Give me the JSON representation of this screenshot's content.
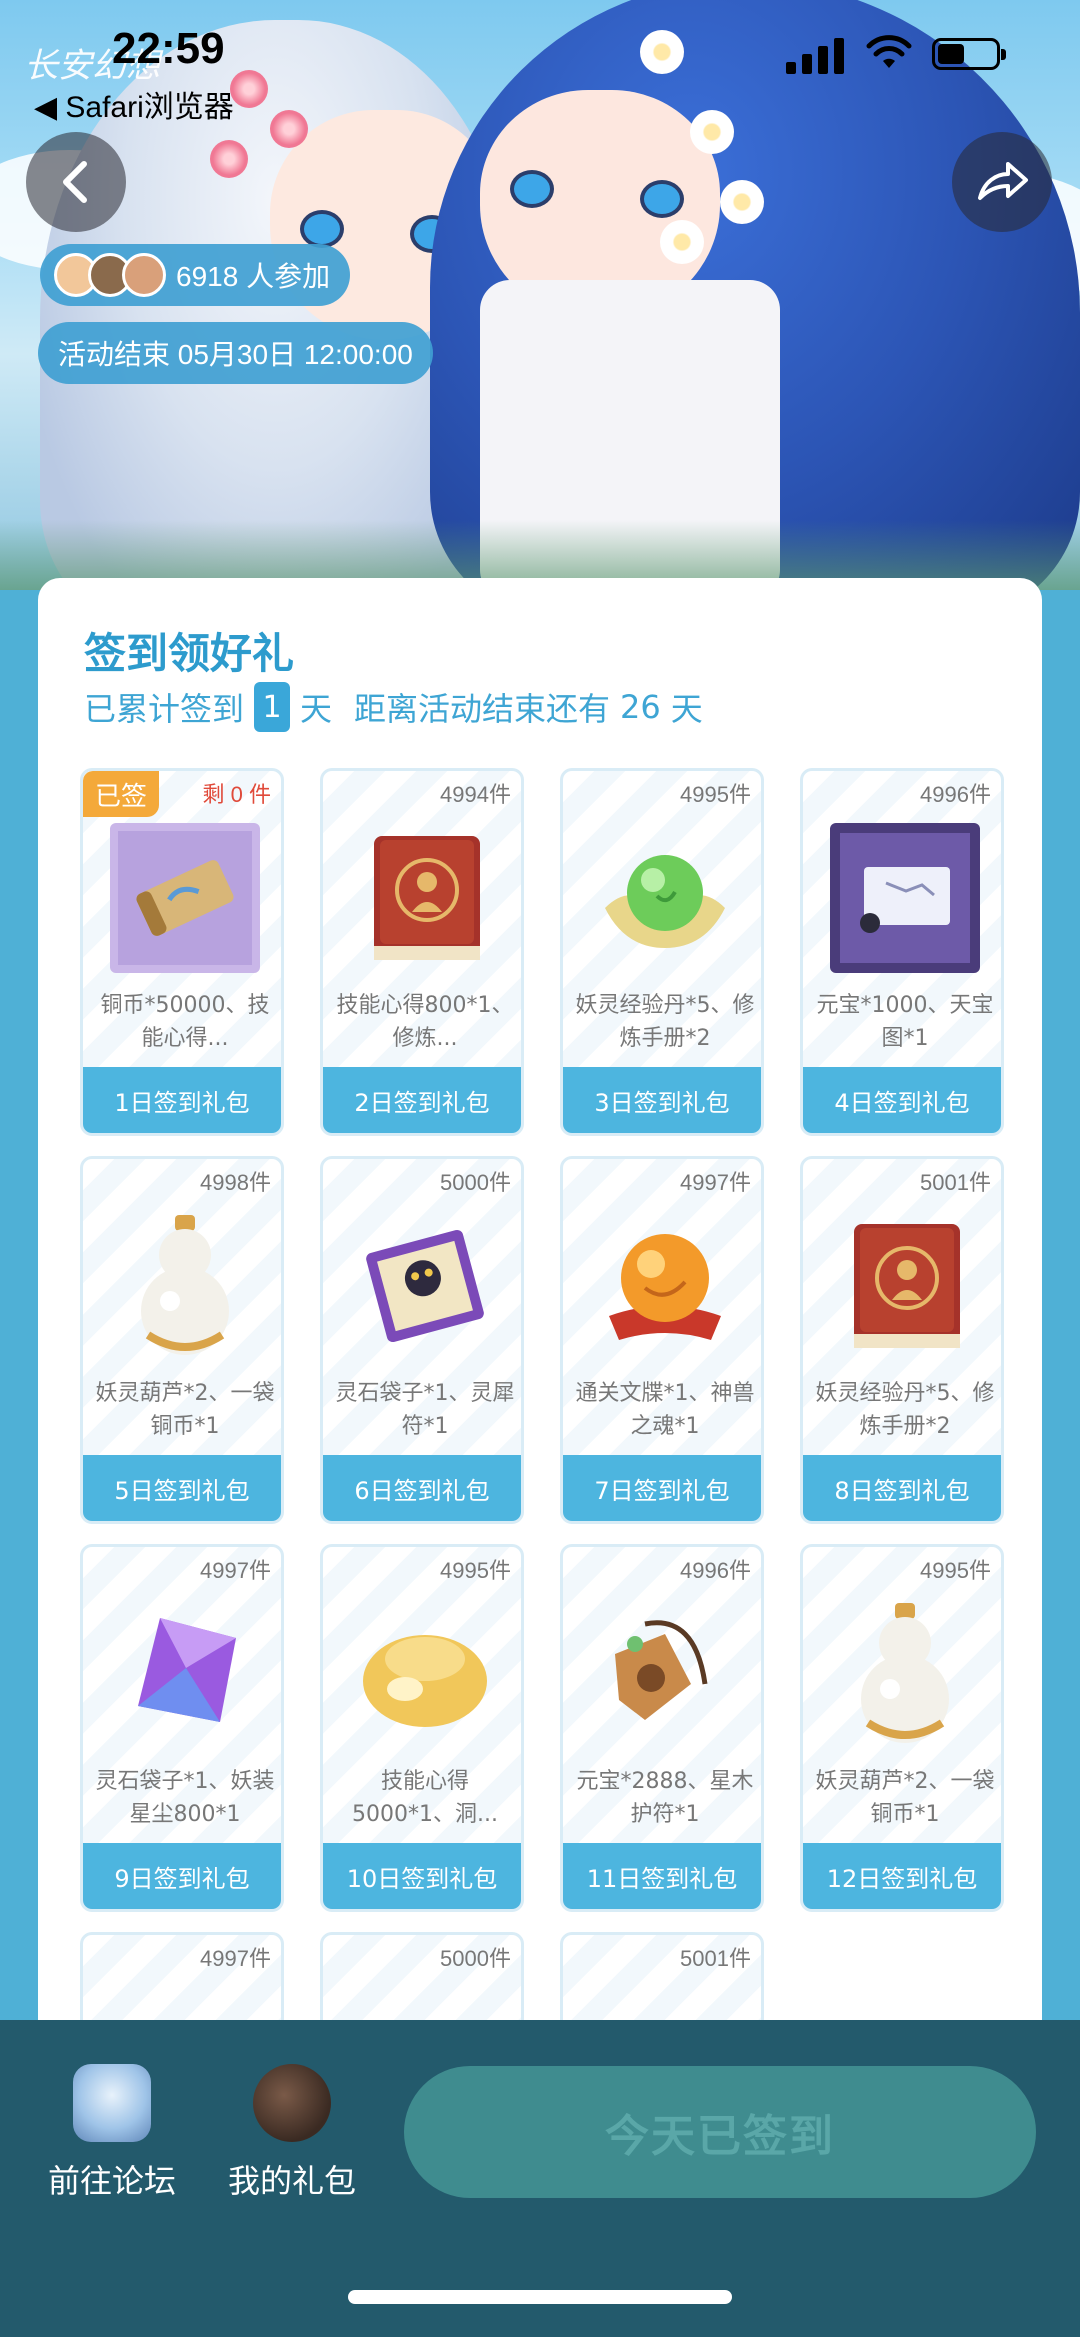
{
  "status_bar": {
    "time": "22:59",
    "back_app": "◀ Safari浏览器",
    "watermark": "长安幻想"
  },
  "hero": {
    "participants": "6918 人参加",
    "end_time": "活动结束 05月30日 12:00:00"
  },
  "card": {
    "title": "签到领好礼",
    "sub_prefix": "已累计签到",
    "days_signed": "1",
    "sub_day": "天",
    "remain_prefix": "距离活动结束还有",
    "remain_days": "26",
    "remain_suffix": "天"
  },
  "gifts": [
    {
      "stock": "剩 0 件",
      "tag": "已签",
      "desc": "铜币*50000、技能心得...",
      "label": "1日签到礼包",
      "icon": "treasure-map-icon"
    },
    {
      "stock": "4994件",
      "desc": "技能心得800*1、修炼...",
      "label": "2日签到礼包",
      "icon": "skill-book-icon"
    },
    {
      "stock": "4995件",
      "desc": "妖灵经验丹*5、修炼手册*2",
      "label": "3日签到礼包",
      "icon": "green-pill-icon"
    },
    {
      "stock": "4996件",
      "desc": "元宝*1000、天宝图*1",
      "label": "4日签到礼包",
      "icon": "scroll-map-icon"
    },
    {
      "stock": "4998件",
      "desc": "妖灵葫芦*2、一袋铜币*1",
      "label": "5日签到礼包",
      "icon": "gourd-icon"
    },
    {
      "stock": "5000件",
      "desc": "灵石袋子*1、灵犀符*1",
      "label": "6日签到礼包",
      "icon": "talisman-icon"
    },
    {
      "stock": "4997件",
      "desc": "通关文牒*1、神兽之魂*1",
      "label": "7日签到礼包",
      "icon": "orb-icon"
    },
    {
      "stock": "5001件",
      "desc": "妖灵经验丹*5、修炼手册*2",
      "label": "8日签到礼包",
      "icon": "skill-book-icon"
    },
    {
      "stock": "4997件",
      "desc": "灵石袋子*1、妖装星尘800*1",
      "label": "9日签到礼包",
      "icon": "crystal-icon"
    },
    {
      "stock": "4995件",
      "desc": "技能心得5000*1、洞...",
      "label": "10日签到礼包",
      "icon": "gold-pouch-icon"
    },
    {
      "stock": "4996件",
      "desc": "元宝*2888、星木护符*1",
      "label": "11日签到礼包",
      "icon": "wood-charm-icon"
    },
    {
      "stock": "4995件",
      "desc": "妖灵葫芦*2、一袋铜币*1",
      "label": "12日签到礼包",
      "icon": "gourd-icon"
    },
    {
      "stock": "4997件",
      "desc": "",
      "label": "",
      "icon": "red-scroll-icon"
    },
    {
      "stock": "5000件",
      "desc": "",
      "label": "",
      "icon": "gourd-icon"
    },
    {
      "stock": "5001件",
      "desc": "",
      "label": "",
      "icon": "box-icon"
    }
  ],
  "bottom_bar": {
    "forum": "前往论坛",
    "my_gifts": "我的礼包",
    "signed_button": "今天已签到"
  },
  "colors": {
    "primary": "#4db5df",
    "title": "#2d9bcd",
    "tag": "#f4a93a",
    "bottom_bg": "#235a6c",
    "disabled_button": "#3f8c8f"
  }
}
